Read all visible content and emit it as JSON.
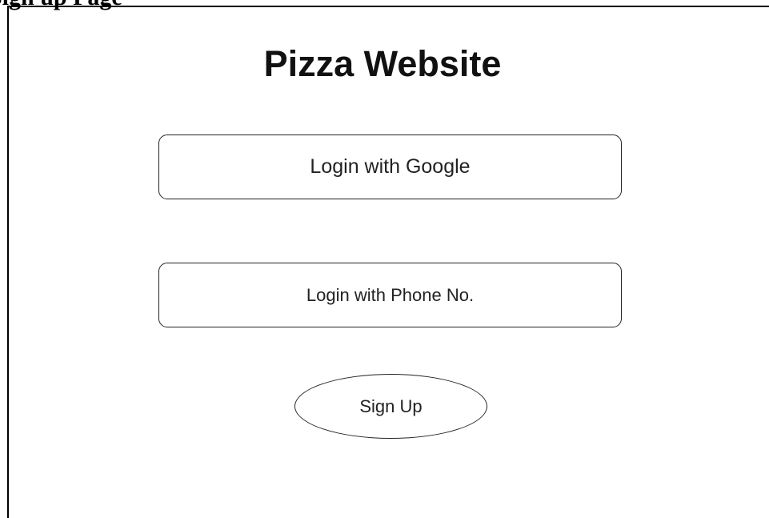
{
  "page_heading": "Sign up Page",
  "title": "Pizza Website",
  "buttons": {
    "google_login": "Login with Google",
    "phone_login": "Login with Phone No.",
    "sign_up": "Sign Up"
  }
}
